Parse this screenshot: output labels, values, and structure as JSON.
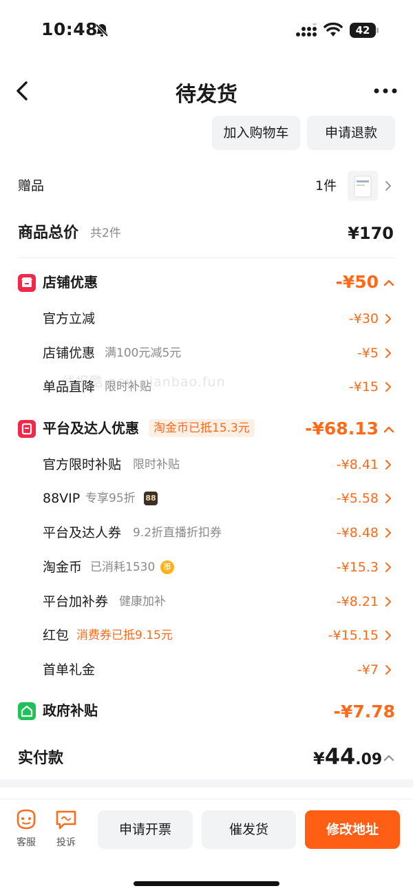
{
  "status": {
    "time": "10:48",
    "battery": "42"
  },
  "nav": {
    "title": "待发货"
  },
  "top_actions": {
    "add_cart": "加入购物车",
    "refund": "申请退款"
  },
  "gift": {
    "label": "赠品",
    "qty": "1件"
  },
  "total": {
    "label": "商品总价",
    "count": "共2件",
    "value": "¥170"
  },
  "shop_discount": {
    "title": "店铺优惠",
    "amount": "-¥50",
    "items": [
      {
        "label": "官方立减",
        "sub": "",
        "amount": "-¥30"
      },
      {
        "label": "店铺优惠",
        "sub": "满100元减5元",
        "amount": "-¥5"
      },
      {
        "label": "单品直降",
        "sub": "限时补贴",
        "amount": "-¥15"
      }
    ]
  },
  "platform_discount": {
    "title": "平台及达人优惠",
    "tag": "淘金币已抵15.3元",
    "amount": "-¥68.13",
    "items": [
      {
        "label": "官方限时补贴",
        "sub": "限时补贴",
        "amount": "-¥8.41"
      },
      {
        "label": "88VIP",
        "sub": "专享95折",
        "badge": "88",
        "amount": "-¥5.58"
      },
      {
        "label": "平台及达人券",
        "sub": "9.2折直播折扣券",
        "amount": "-¥8.48"
      },
      {
        "label": "淘金币",
        "sub": "已消耗1530",
        "badge": "币",
        "amount": "-¥15.3"
      },
      {
        "label": "平台加补券",
        "sub": "健康加补",
        "amount": "-¥8.21"
      },
      {
        "label": "红包",
        "sub": "消费券已抵9.15元",
        "amount": "-¥15.15"
      },
      {
        "label": "首单礼金",
        "sub": "",
        "amount": "-¥7"
      }
    ]
  },
  "gov_subsidy": {
    "title": "政府补贴",
    "amount": "-¥7.78"
  },
  "paid": {
    "label": "实付款",
    "yen": "¥",
    "int": "44",
    "dec": ".09"
  },
  "watermark": "线报酷 new.xianbao.fun",
  "bottom": {
    "service": "客服",
    "complaint": "投诉",
    "invoice": "申请开票",
    "urge": "催发货",
    "edit_address": "修改地址"
  },
  "colors": {
    "accent": "#ff6a1a",
    "primary_button": "#ff5e14",
    "shop_icon": "#f2274a",
    "gov_icon": "#1fc25a"
  }
}
